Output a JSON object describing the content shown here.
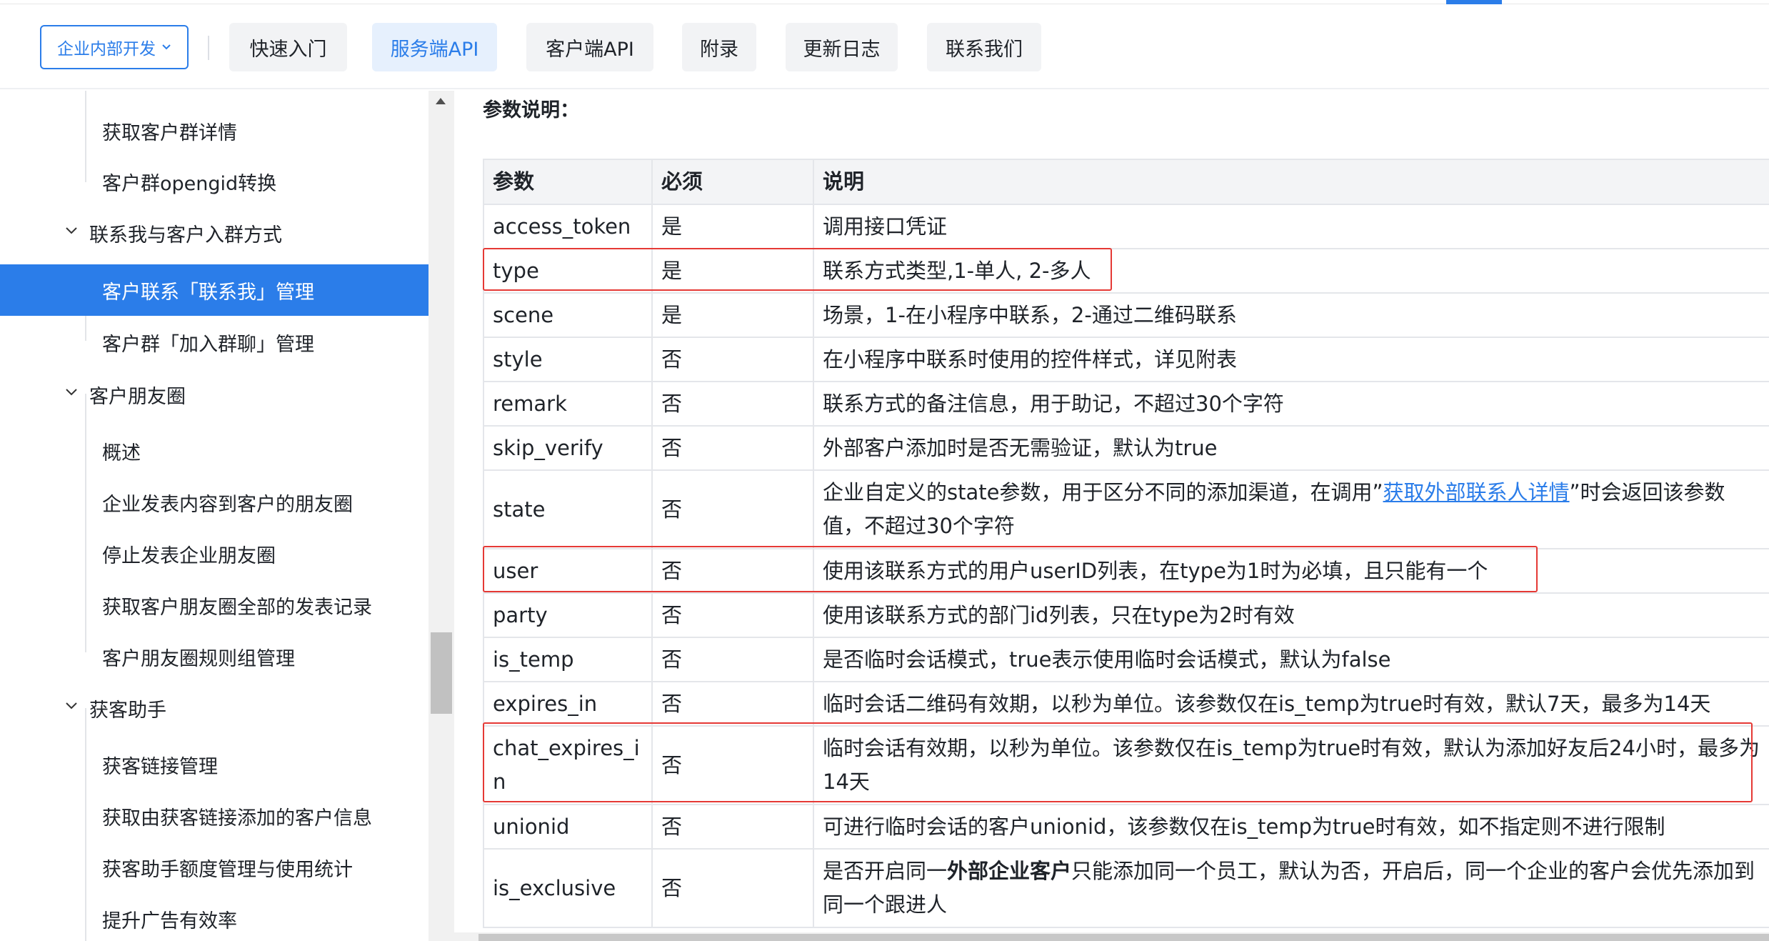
{
  "nav": {
    "dev_select": "企业内部开发",
    "tabs": [
      {
        "label": "快速入门",
        "active": false
      },
      {
        "label": "服务端API",
        "active": true
      },
      {
        "label": "客户端API",
        "active": false
      },
      {
        "label": "附录",
        "active": false
      },
      {
        "label": "更新日志",
        "active": false
      },
      {
        "label": "联系我们",
        "active": false
      }
    ]
  },
  "sidebar": {
    "items": [
      {
        "label": "获取客户群详情",
        "kind": "child"
      },
      {
        "label": "客户群opengid转换",
        "kind": "child"
      },
      {
        "label": "联系我与客户入群方式",
        "kind": "parent"
      },
      {
        "label": "客户联系「联系我」管理",
        "kind": "child",
        "active": true
      },
      {
        "label": "客户群「加入群聊」管理",
        "kind": "child"
      },
      {
        "label": "客户朋友圈",
        "kind": "parent"
      },
      {
        "label": "概述",
        "kind": "child"
      },
      {
        "label": "企业发表内容到客户的朋友圈",
        "kind": "child"
      },
      {
        "label": "停止发表企业朋友圈",
        "kind": "child"
      },
      {
        "label": "获取客户朋友圈全部的发表记录",
        "kind": "child"
      },
      {
        "label": "客户朋友圈规则组管理",
        "kind": "child"
      },
      {
        "label": "获客助手",
        "kind": "parent"
      },
      {
        "label": "获客链接管理",
        "kind": "child"
      },
      {
        "label": "获取由获客链接添加的客户信息",
        "kind": "child"
      },
      {
        "label": "获客助手额度管理与使用统计",
        "kind": "child"
      },
      {
        "label": "提升广告有效率",
        "kind": "child"
      }
    ]
  },
  "content": {
    "section_title": "参数说明：",
    "table": {
      "headers": [
        "参数",
        "必须",
        "说明"
      ],
      "rows": [
        {
          "param": "access_token",
          "required": "是",
          "desc": "调用接口凭证"
        },
        {
          "param": "type",
          "required": "是",
          "desc": "联系方式类型,1-单人, 2-多人"
        },
        {
          "param": "scene",
          "required": "是",
          "desc": "场景，1-在小程序中联系，2-通过二维码联系"
        },
        {
          "param": "style",
          "required": "否",
          "desc": "在小程序中联系时使用的控件样式，详见附表"
        },
        {
          "param": "remark",
          "required": "否",
          "desc": "联系方式的备注信息，用于助记，不超过30个字符"
        },
        {
          "param": "skip_verify",
          "required": "否",
          "desc": "外部客户添加时是否无需验证，默认为true"
        },
        {
          "param": "state",
          "required": "否",
          "desc_pre": "企业自定义的state参数，用于区分不同的添加渠道，在调用”",
          "desc_link": "获取外部联系人详情",
          "desc_post": "”时会返回该参数值，不超过30个字符"
        },
        {
          "param": "user",
          "required": "否",
          "desc": "使用该联系方式的用户userID列表，在type为1时为必填，且只能有一个"
        },
        {
          "param": "party",
          "required": "否",
          "desc": "使用该联系方式的部门id列表，只在type为2时有效"
        },
        {
          "param": "is_temp",
          "required": "否",
          "desc": "是否临时会话模式，true表示使用临时会话模式，默认为false"
        },
        {
          "param": "expires_in",
          "required": "否",
          "desc": "临时会话二维码有效期，以秒为单位。该参数仅在is_temp为true时有效，默认7天，最多为14天"
        },
        {
          "param": "chat_expires_in",
          "required": "否",
          "desc": "临时会话有效期，以秒为单位。该参数仅在is_temp为true时有效，默认为添加好友后24小时，最多为14天"
        },
        {
          "param": "unionid",
          "required": "否",
          "desc": "可进行临时会话的客户unionid，该参数仅在is_temp为true时有效，如不指定则不进行限制"
        },
        {
          "param": "is_exclusive",
          "required": "否",
          "desc_pre": "是否开启同一",
          "desc_bold": "外部企业客户",
          "desc_post": "只能添加同一个员工，默认为否，开启后，同一个企业的客户会优先添加到同一个跟进人"
        }
      ]
    }
  },
  "colors": {
    "accent": "#2b7de9",
    "highlight": "#e53935"
  }
}
